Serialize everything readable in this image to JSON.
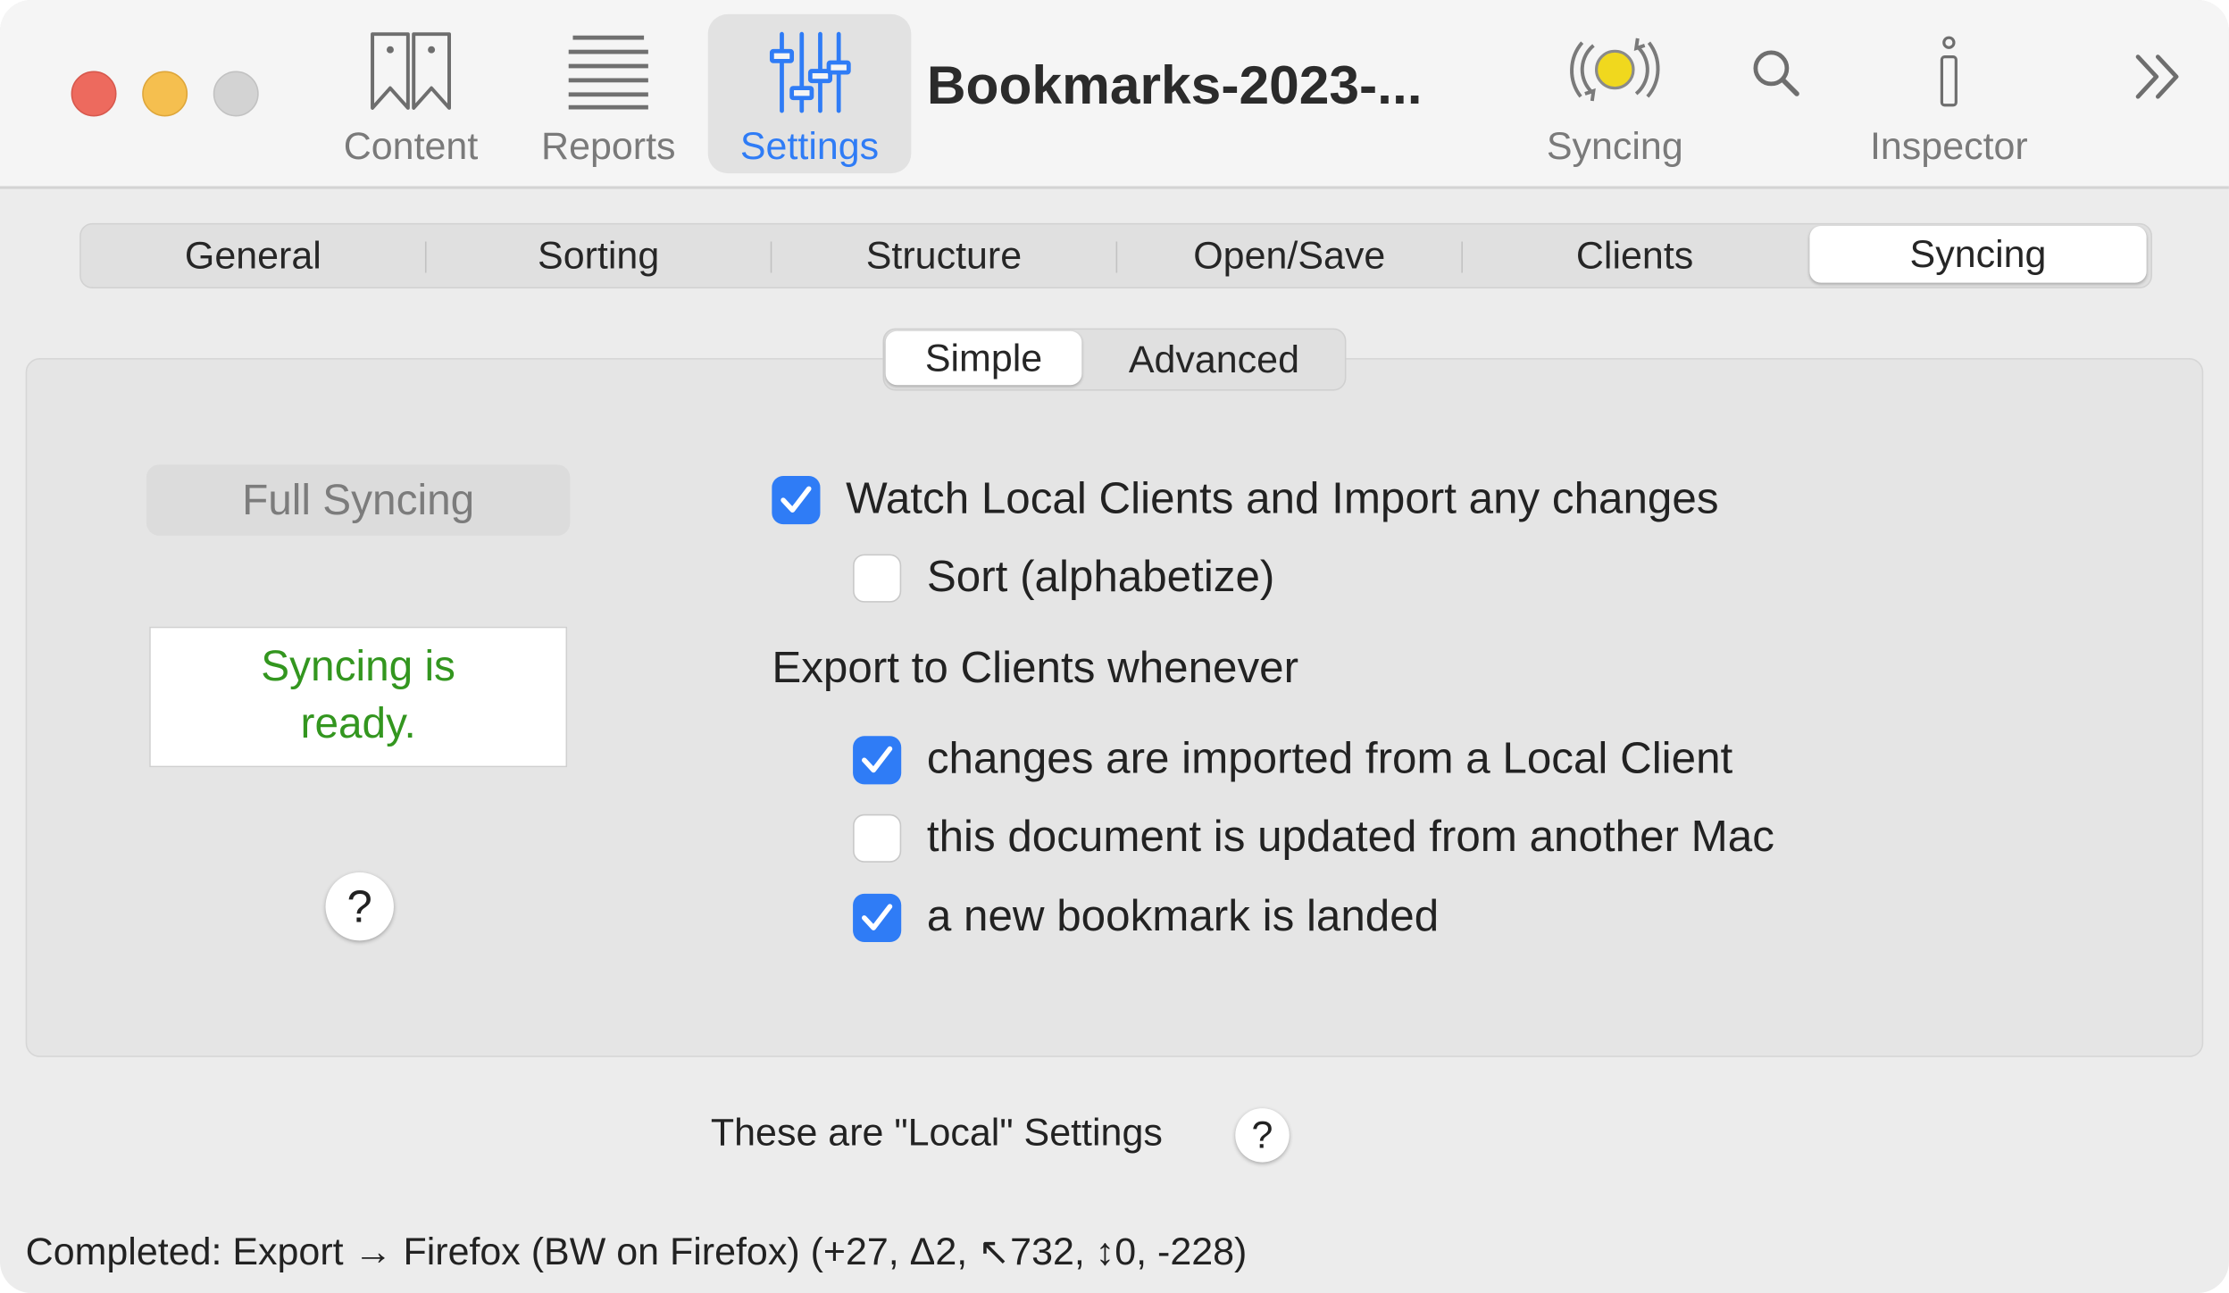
{
  "window": {
    "document_title": "Bookmarks-2023-..."
  },
  "toolbar": {
    "items": [
      {
        "label": "Content",
        "icon": "bookmarks-icon"
      },
      {
        "label": "Reports",
        "icon": "list-lines-icon"
      },
      {
        "label": "Settings",
        "icon": "sliders-icon",
        "selected": true
      },
      {
        "label": "Syncing",
        "icon": "sync-status-icon"
      },
      {
        "label": "",
        "icon": "search-icon"
      },
      {
        "label": "Inspector",
        "icon": "info-icon"
      },
      {
        "label": "",
        "icon": "chevron-double-right-icon"
      }
    ]
  },
  "settings_tabs": {
    "items": [
      "General",
      "Sorting",
      "Structure",
      "Open/Save",
      "Clients",
      "Syncing"
    ],
    "selected": "Syncing"
  },
  "mode_tabs": {
    "items": [
      "Simple",
      "Advanced"
    ],
    "selected": "Simple"
  },
  "left_panel": {
    "full_syncing_button": "Full Syncing",
    "status_line1": "Syncing is",
    "status_line2": "ready.",
    "help_label": "?"
  },
  "options": {
    "watch_local": {
      "label": "Watch Local Clients and Import any changes",
      "checked": true
    },
    "sort_alpha": {
      "label": "Sort (alphabetize)",
      "checked": false
    },
    "export_heading": "Export to Clients whenever",
    "export_imported": {
      "label": "changes are imported from a Local Client",
      "checked": true
    },
    "export_other_mac": {
      "label": "this document is updated from another Mac",
      "checked": false
    },
    "export_new_bookmark": {
      "label": "a new bookmark is landed",
      "checked": true
    }
  },
  "footer": {
    "local_note": "These are \"Local\" Settings",
    "help_label": "?",
    "status": "Completed: Export → Firefox (BW on Firefox) (+27, Δ2, ↖732, ↕0, -228)"
  },
  "colors": {
    "accent": "#2f7cf6",
    "status_green": "#33961f",
    "close": "#ed6a5e",
    "minimize": "#f5bf4f",
    "zoom_disabled": "#d3d3d3",
    "sync_indicator": "#f0d81e"
  }
}
